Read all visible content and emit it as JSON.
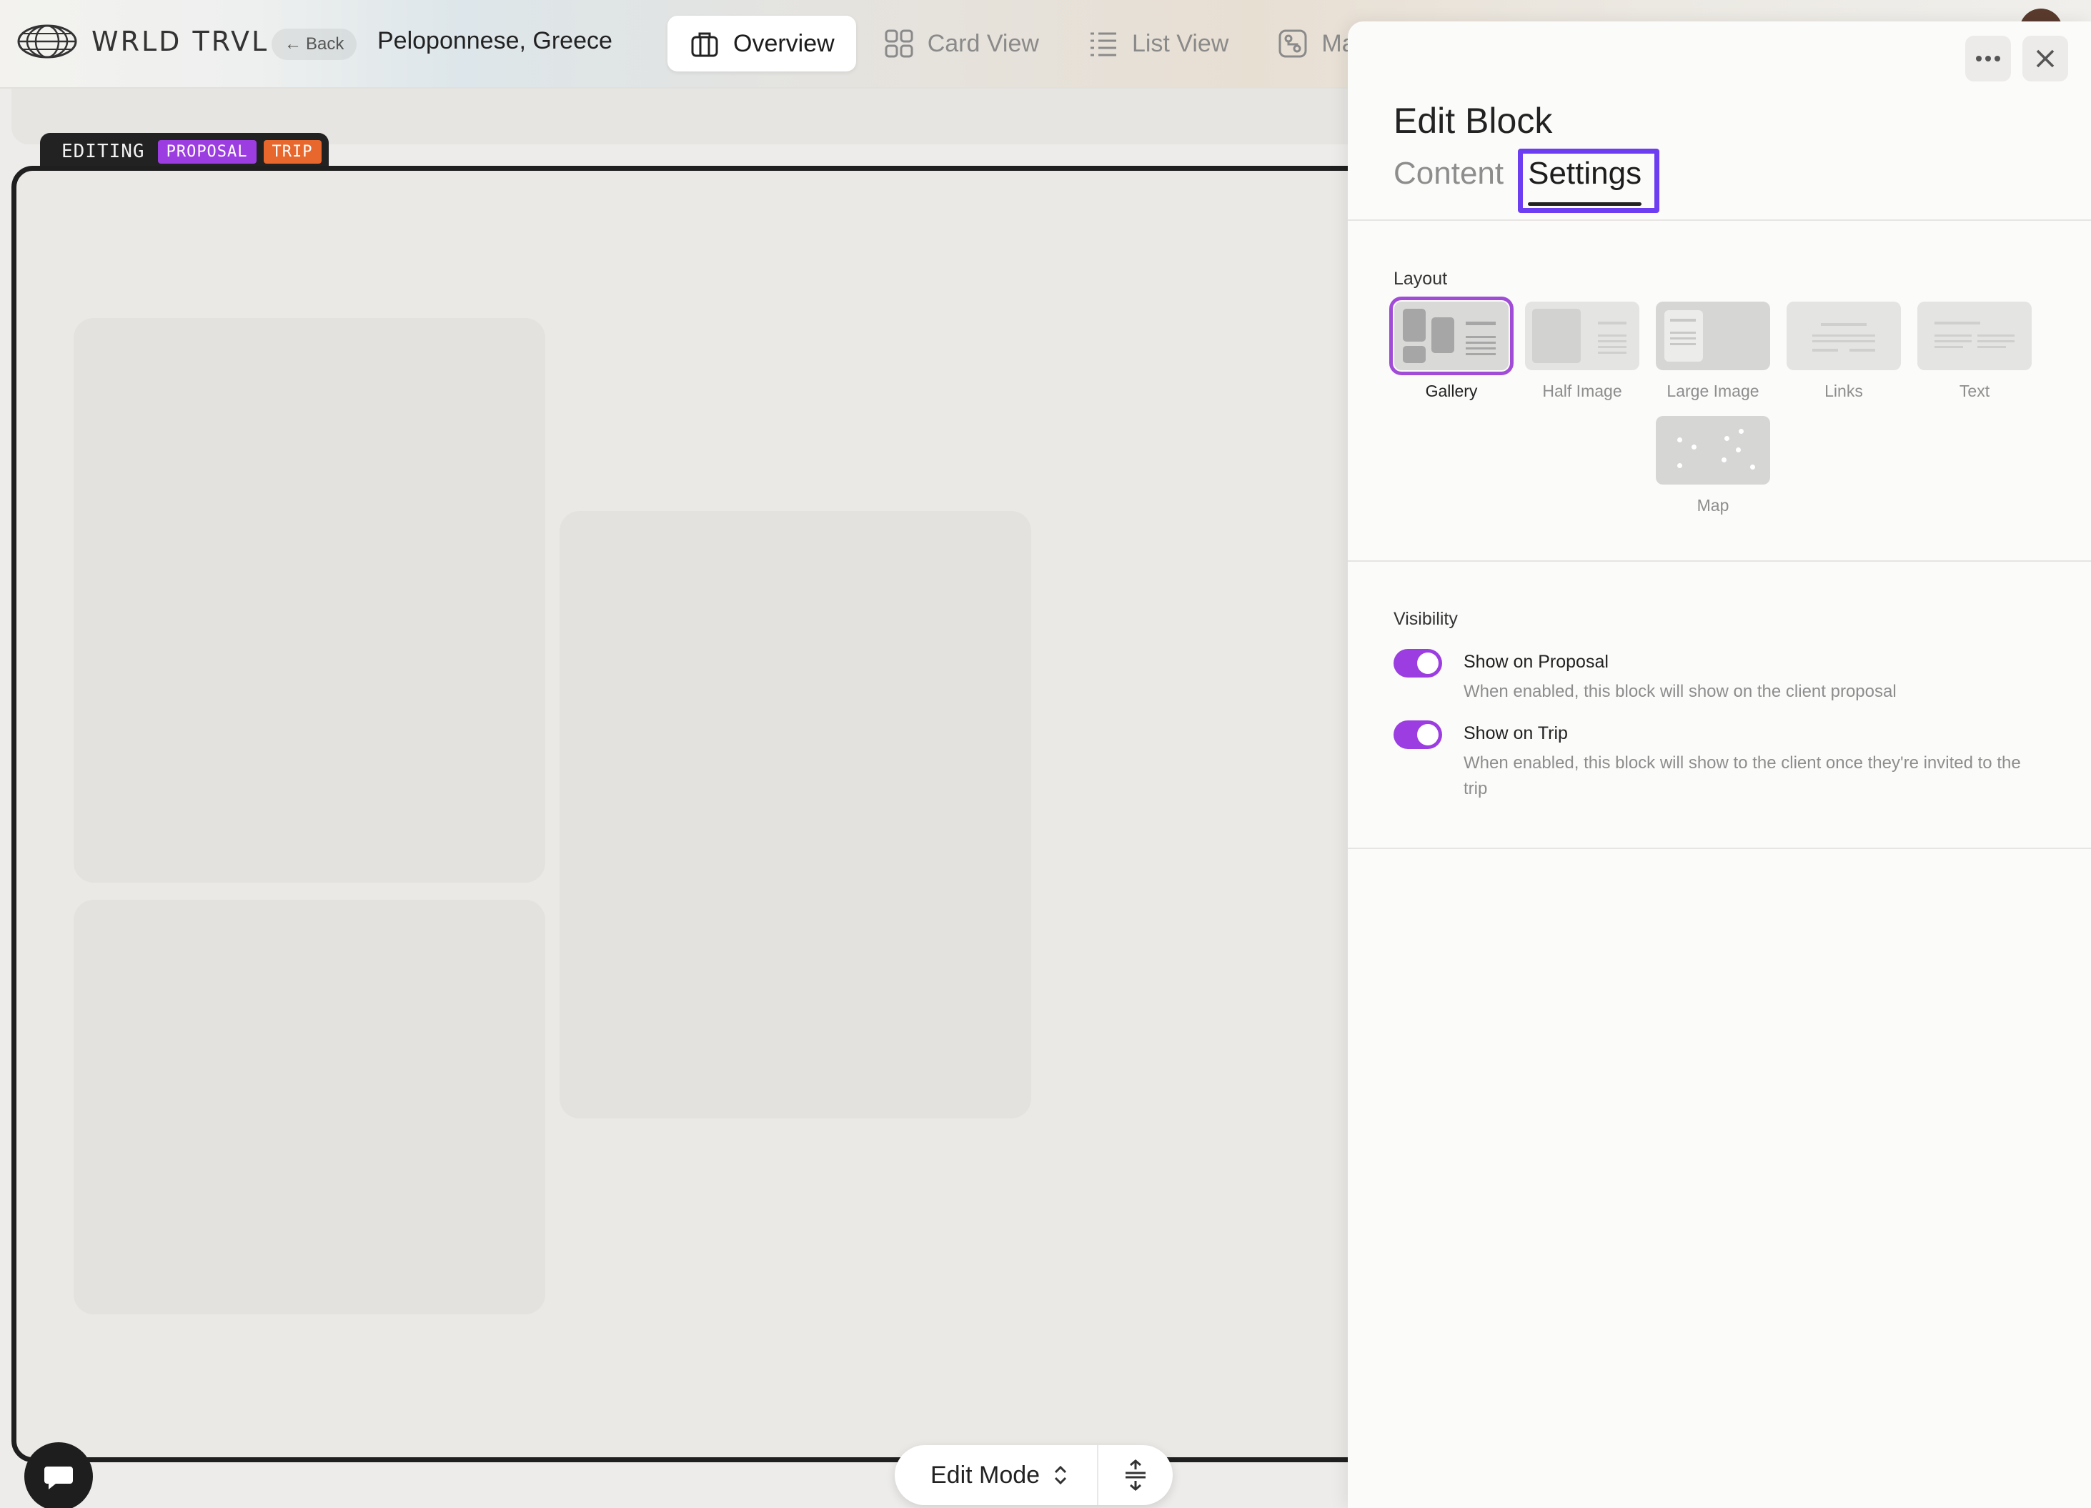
{
  "app": {
    "brand": "WRLD TRVL",
    "back_label": "Back",
    "trip_title": "Peloponnese, Greece"
  },
  "nav": {
    "tabs": [
      {
        "label": "Overview",
        "icon": "briefcase-icon"
      },
      {
        "label": "Card View",
        "icon": "grid-icon"
      },
      {
        "label": "List View",
        "icon": "list-icon"
      },
      {
        "label": "Ma",
        "icon": "map-route-icon"
      }
    ]
  },
  "editing": {
    "label": "EDITING",
    "chips": [
      {
        "label": "PROPOSAL",
        "color": "#9b3de0"
      },
      {
        "label": "TRIP",
        "color": "#e8672c"
      }
    ]
  },
  "toolbar": {
    "edit_mode_label": "Edit Mode"
  },
  "panel": {
    "title": "Edit Block",
    "tabs": [
      {
        "label": "Content"
      },
      {
        "label": "Settings"
      }
    ],
    "layout": {
      "label": "Layout",
      "options": [
        {
          "label": "Gallery"
        },
        {
          "label": "Half Image"
        },
        {
          "label": "Large Image"
        },
        {
          "label": "Links"
        },
        {
          "label": "Text"
        },
        {
          "label": "Map"
        }
      ]
    },
    "visibility": {
      "label": "Visibility",
      "toggles": [
        {
          "title": "Show on Proposal",
          "desc": "When enabled, this block will show on the client proposal"
        },
        {
          "title": "Show on Trip",
          "desc": "When enabled, this block will show to the client once they're invited to the trip"
        }
      ]
    }
  },
  "colors": {
    "accent": "#9b3de0",
    "focus": "#6d3df2",
    "trip_chip": "#e8672c"
  }
}
